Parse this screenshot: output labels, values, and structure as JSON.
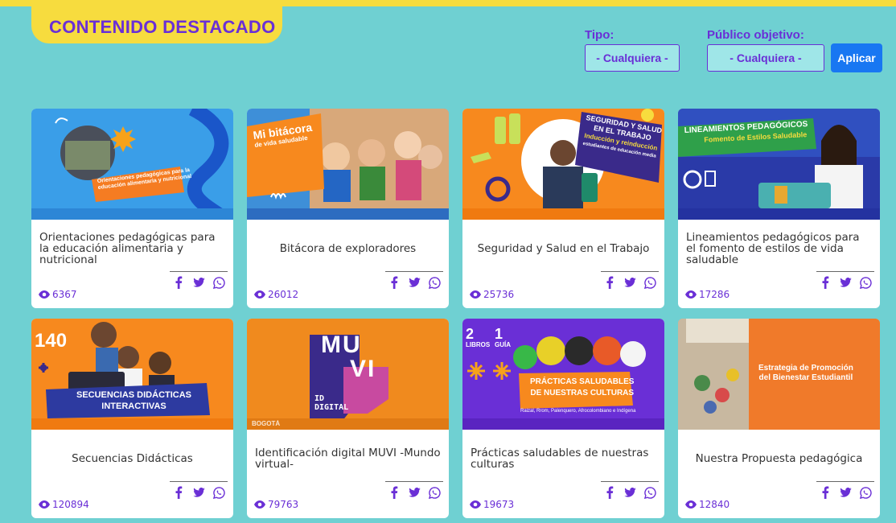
{
  "header": {
    "title": "CONTENIDO DESTACADO"
  },
  "filters": {
    "tipo_label": "Tipo:",
    "tipo_value": "- Cualquiera -",
    "publico_label": "Público objetivo:",
    "publico_value": "- Cualquiera -",
    "apply_label": "Aplicar"
  },
  "colors": {
    "accent": "#6a2fd6",
    "background": "#6fd0d2",
    "highlight": "#f7dc3e",
    "button": "#1877f2"
  },
  "share_icons": [
    "facebook-icon",
    "twitter-icon",
    "whatsapp-icon"
  ],
  "cards": [
    {
      "title": "Orientaciones pedagógicas para la educación alimentaria y nutricional",
      "views": "6367",
      "image_text": {
        "line1": "Orientaciones pedagógicas para la",
        "line2": "educación alimentaria y nutricional"
      }
    },
    {
      "title": "Bitácora de exploradores",
      "views": "26012",
      "image_text": {
        "line1": "Mi bitácora",
        "line2": "de vida saludable"
      }
    },
    {
      "title": "Seguridad y Salud en el Trabajo",
      "views": "25736",
      "image_text": {
        "line1": "SEGURIDAD Y SALUD",
        "line2": "EN EL TRABAJO",
        "line3": "Inducción y reinducción",
        "line4": "estudiantes de educación media"
      }
    },
    {
      "title": "Lineamientos pedagógicos para el fomento de estilos de vida saludable",
      "views": "17286",
      "image_text": {
        "line1": "LINEAMIENTOS PEDAGÓGICOS",
        "line2": "Fomento de Estilos Saludable"
      }
    },
    {
      "title": "Secuencias Didácticas",
      "views": "120894",
      "image_text": {
        "line1": "140",
        "line2": "SECUENCIAS DIDÁCTICAS",
        "line3": "INTERACTIVAS"
      }
    },
    {
      "title": "Identificación digital MUVI -Mundo virtual-",
      "views": "79763",
      "image_text": {
        "line1": "MU",
        "line2": "VI",
        "line3": "ID",
        "line4": "DIGITAL",
        "line5": "BOGOTÁ"
      }
    },
    {
      "title": "Prácticas saludables de nuestras culturas",
      "views": "19673",
      "image_text": {
        "line1": "2",
        "line2": "LIBROS",
        "line3": "1",
        "line4": "GUÍA",
        "line5": "PRÁCTICAS SALUDABLES",
        "line6": "DE NUESTRAS CULTURAS",
        "line7": "Raizal, Rrom, Palenquero, Afrocolombiano e Indígena"
      }
    },
    {
      "title": "Nuestra Propuesta pedagógica",
      "views": "12840",
      "image_text": {
        "line1": "Estrategia de Promoción",
        "line2": "del Bienestar Estudiantil"
      }
    }
  ]
}
